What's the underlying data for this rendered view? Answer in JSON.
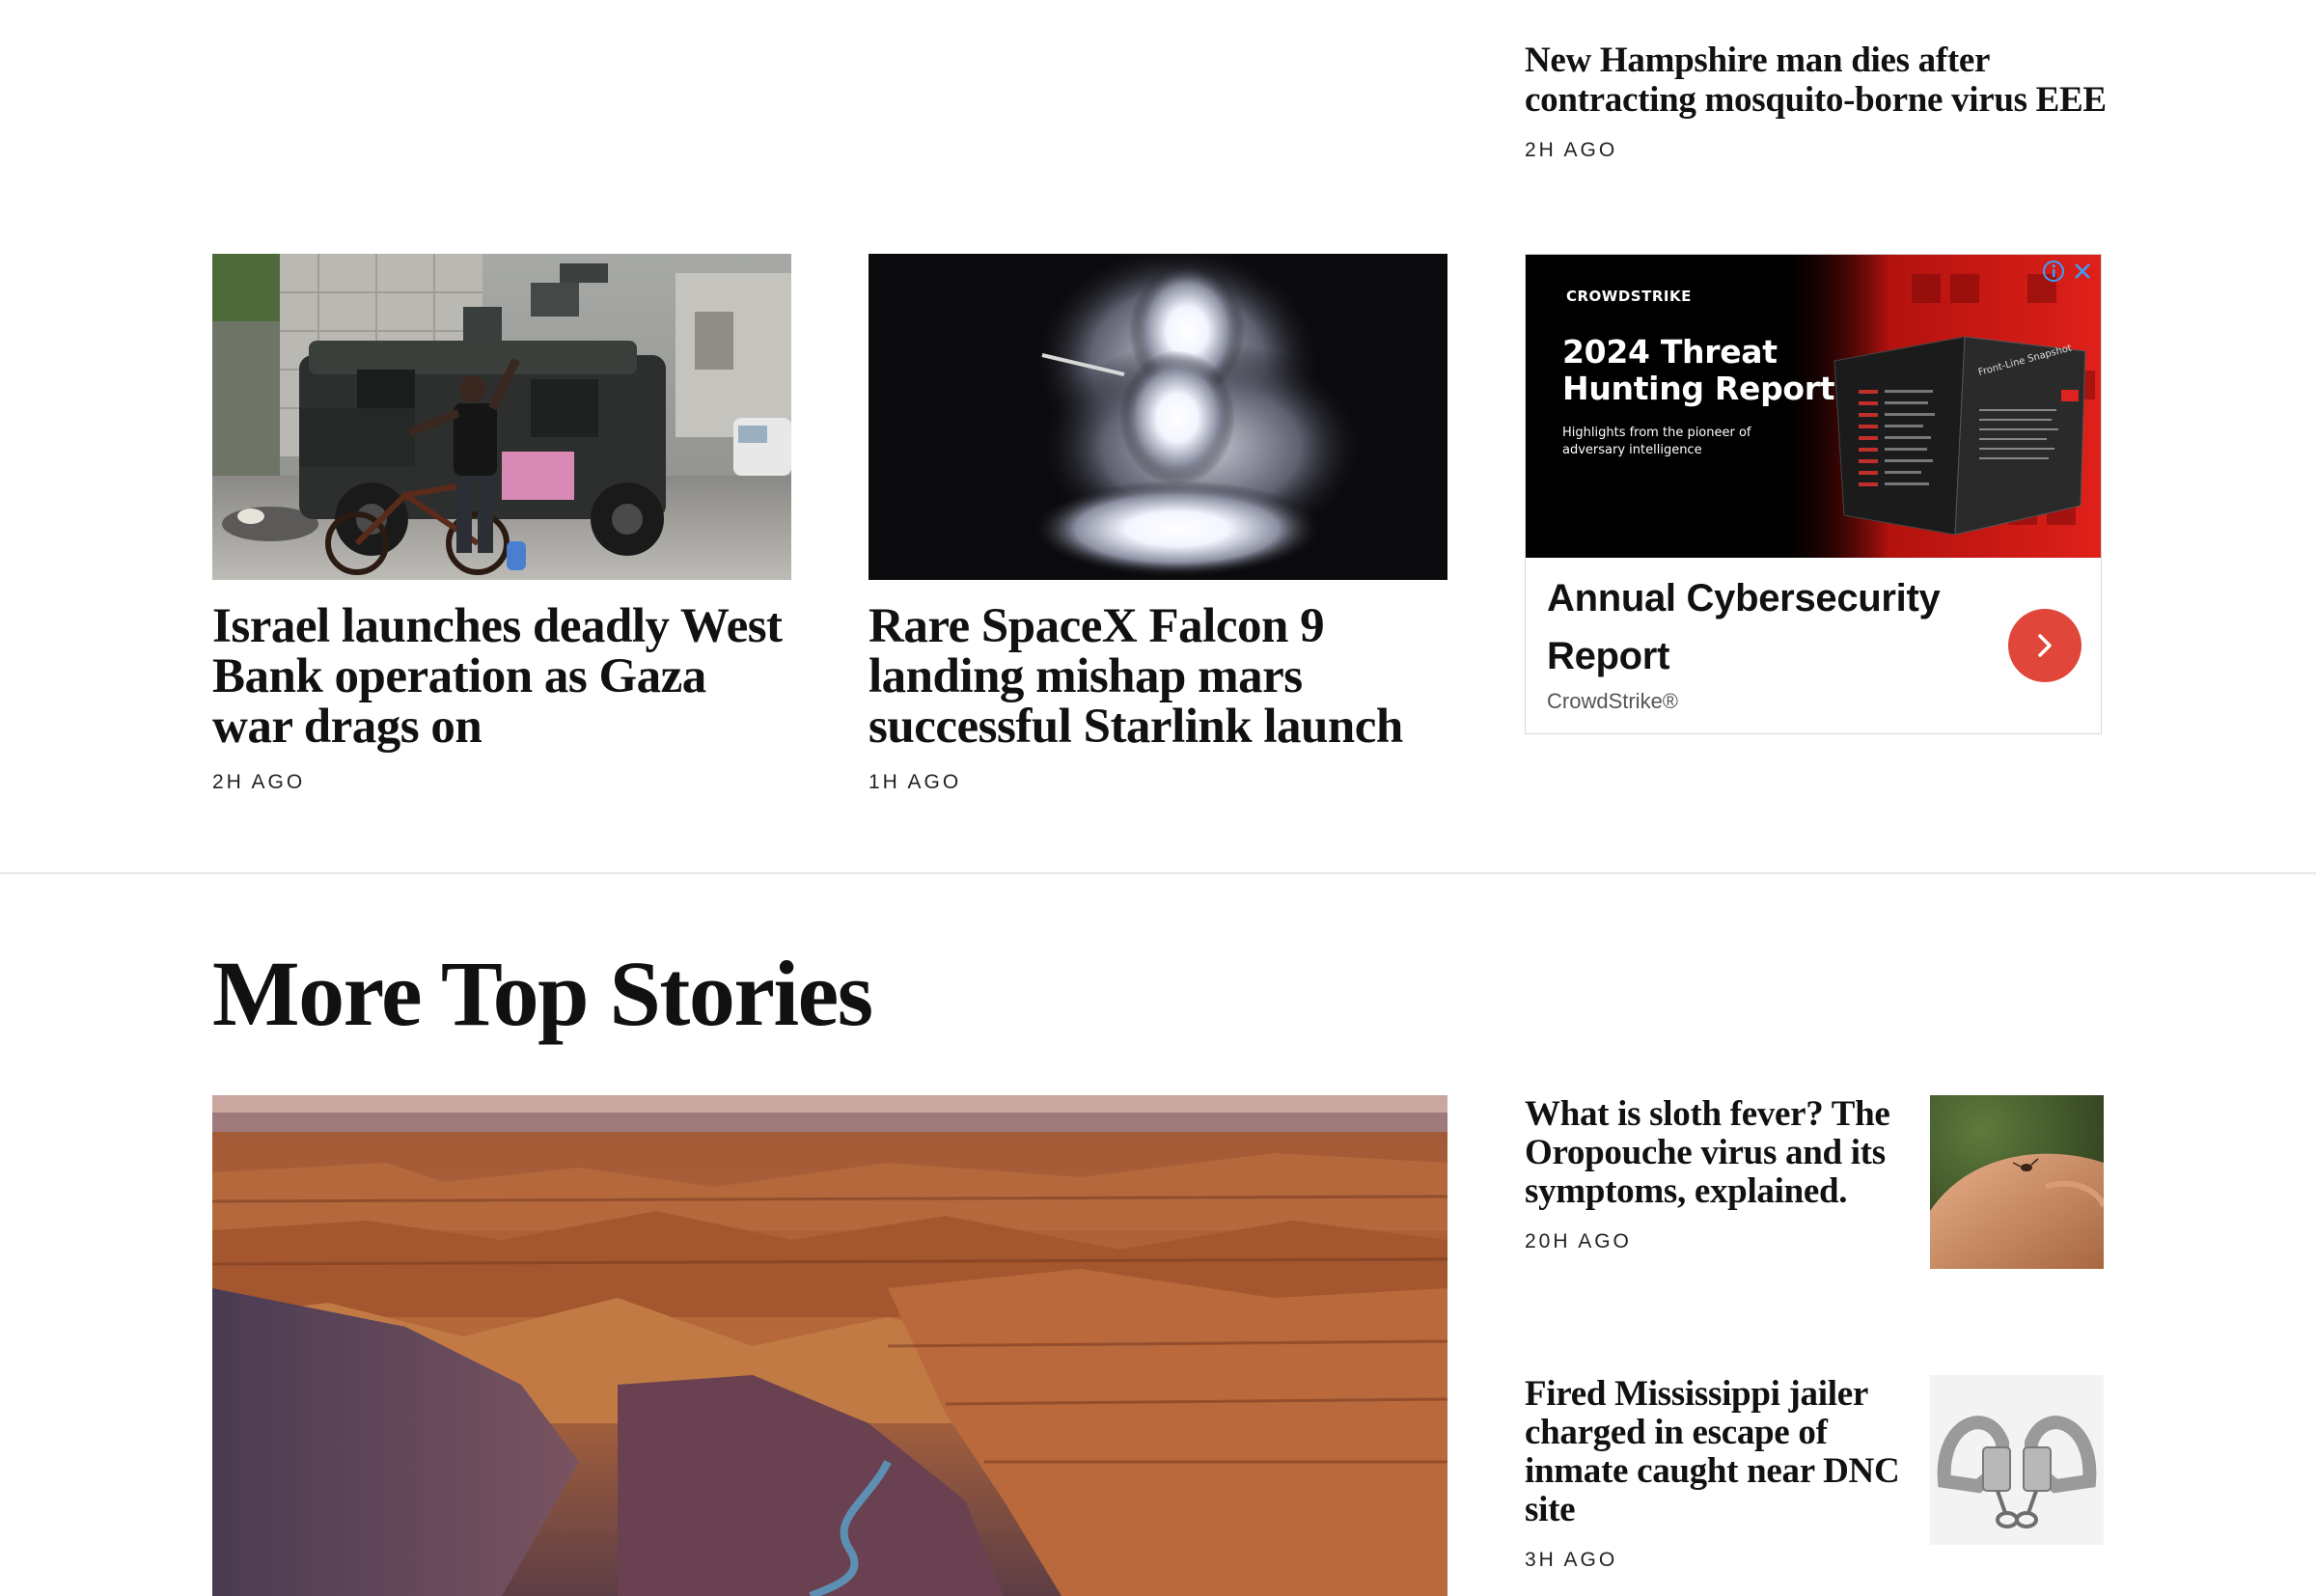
{
  "top_right_article": {
    "headline": "New Hampshire man dies after contracting mosquito-borne virus EEE",
    "timestamp": "2H AGO"
  },
  "cards": [
    {
      "headline": "Israel launches deadly West Bank operation as Gaza war drags on",
      "timestamp": "2H AGO"
    },
    {
      "headline": "Rare SpaceX Falcon 9 landing mishap mars successful Starlink launch",
      "timestamp": "1H AGO"
    }
  ],
  "ad": {
    "brand": "CROWDSTRIKE",
    "report_title": "2024 Threat Hunting Report",
    "report_subtitle": "Highlights from the pioneer of adversary intelligence",
    "magazine_label": "Front-Line Snapshot",
    "cta_title": "Annual Cybersecurity Report",
    "advertiser": "CrowdStrike®",
    "accent_color": "#e1463a"
  },
  "more_top_stories": {
    "title": "More Top Stories",
    "side_stories": [
      {
        "headline": "What is sloth fever? The Oropouche virus and its symptoms, explained.",
        "timestamp": "20H AGO"
      },
      {
        "headline": "Fired Mississippi jailer charged in escape of inmate caught near DNC site",
        "timestamp": "3H AGO"
      }
    ]
  },
  "icons": {
    "ad_info": "info-icon",
    "ad_close": "close-icon",
    "cta": "chevron-right-icon"
  }
}
